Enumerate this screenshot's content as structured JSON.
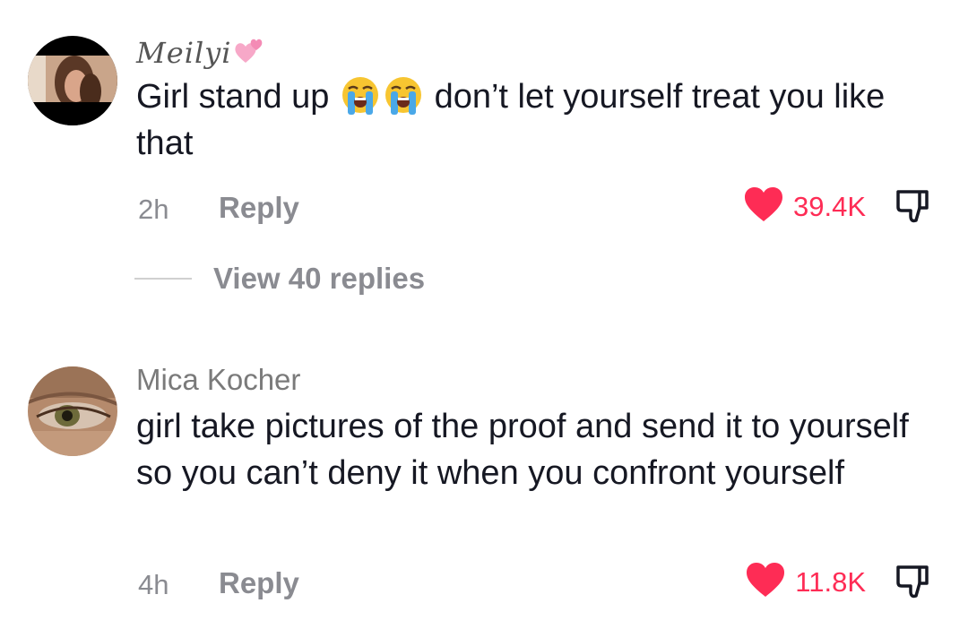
{
  "comments": [
    {
      "username": "Meilyi",
      "text_before_emoji": "Girl stand up",
      "emoji": [
        "loudly-crying-face-icon",
        "loudly-crying-face-icon"
      ],
      "text_after_emoji": "don’t let yourself treat you like that",
      "time": "2h",
      "reply_label": "Reply",
      "like_count": "39.4K",
      "view_replies": "View 40 replies",
      "name_icon": "pink-hearts-icon"
    },
    {
      "username": "Mica Kocher",
      "text": "girl take pictures of the proof and send it to yourself so you can’t deny it when you confront yourself",
      "time": "4h",
      "reply_label": "Reply",
      "like_count": "11.8K"
    }
  ],
  "colors": {
    "like_red": "#fe2c55",
    "meta_gray": "#8a8b91",
    "text_dark": "#161823"
  }
}
